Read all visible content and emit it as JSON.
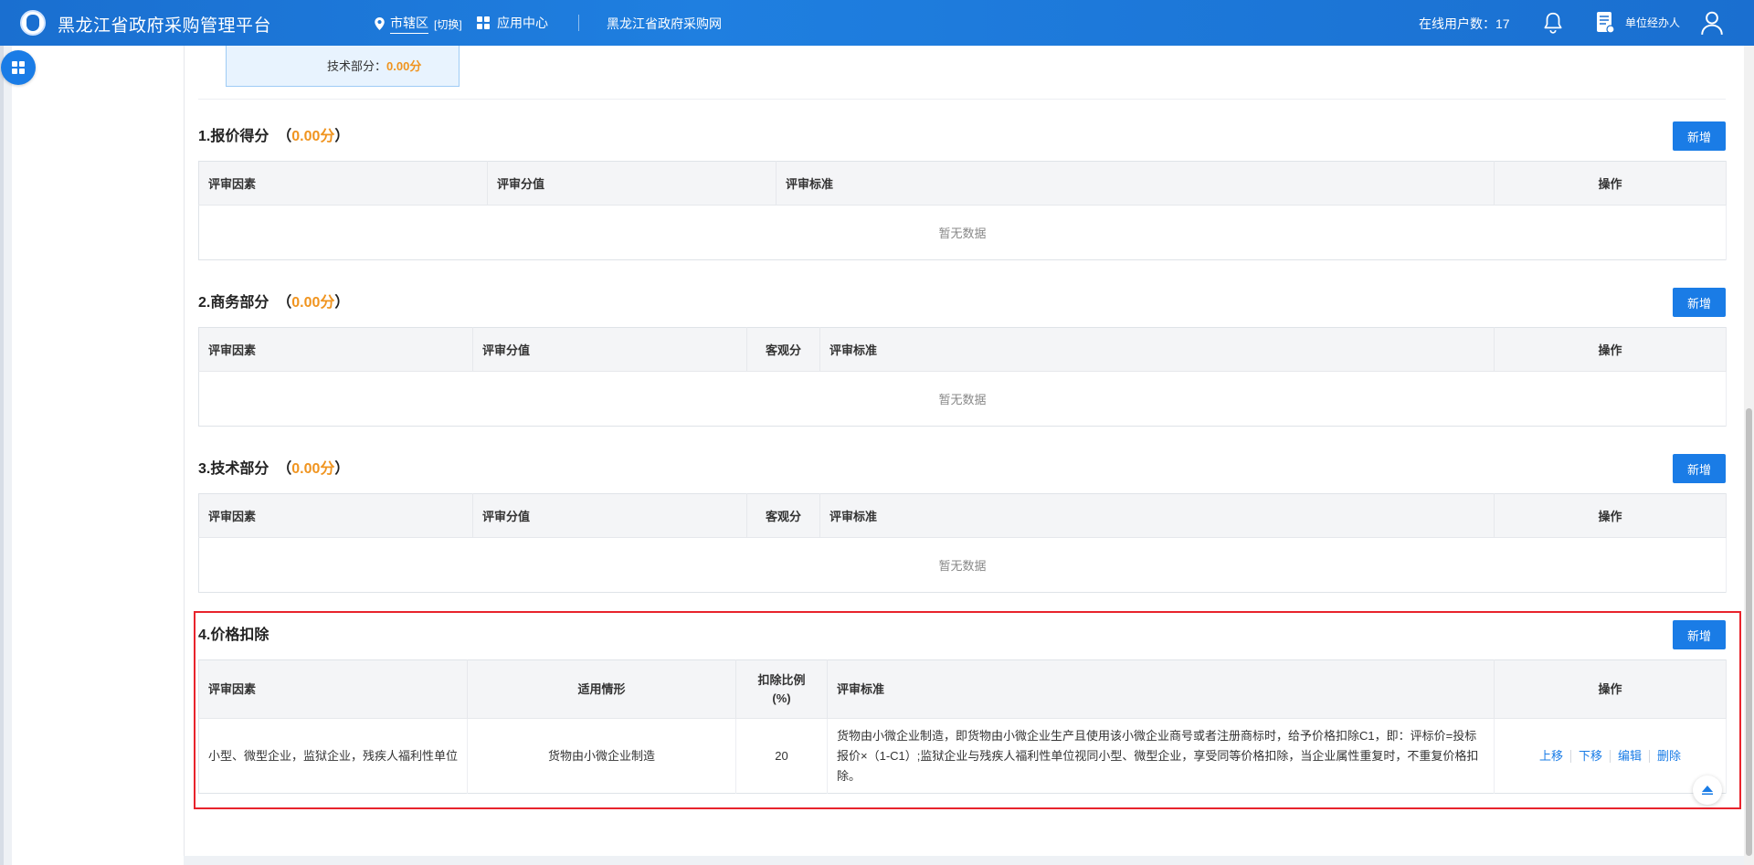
{
  "header": {
    "title": "黑龙江省政府采购管理平台",
    "region": "市辖区",
    "region_switch": "[切换]",
    "app_center": "应用中心",
    "portal_link": "黑龙江省政府采购网",
    "online_label": "在线用户数：17",
    "role": "单位经办人"
  },
  "summary": {
    "tech_label": "技术部分：",
    "tech_score": "0.00分"
  },
  "sections": [
    {
      "title": "1.报价得分",
      "score": "0.00分",
      "add_label": "新增",
      "columns": [
        "评审因素",
        "评审分值",
        "评审标准",
        "操作"
      ],
      "empty_text": "暂无数据"
    },
    {
      "title": "2.商务部分",
      "score": "0.00分",
      "add_label": "新增",
      "columns": [
        "评审因素",
        "评审分值",
        "客观分",
        "评审标准",
        "操作"
      ],
      "empty_text": "暂无数据"
    },
    {
      "title": "3.技术部分",
      "score": "0.00分",
      "add_label": "新增",
      "columns": [
        "评审因素",
        "评审分值",
        "客观分",
        "评审标准",
        "操作"
      ],
      "empty_text": "暂无数据"
    },
    {
      "title": "4.价格扣除",
      "add_label": "新增",
      "columns": [
        "评审因素",
        "适用情形",
        "扣除比例",
        "(%)",
        "评审标准",
        "操作"
      ],
      "rows": [
        {
          "factor": "小型、微型企业，监狱企业，残疾人福利性单位",
          "situation": "货物由小微企业制造",
          "ratio": "20",
          "standard": "货物由小微企业制造，即货物由小微企业生产且使用该小微企业商号或者注册商标时，给予价格扣除C1，即：评标价=投标报价×（1-C1）;监狱企业与残疾人福利性单位视同小型、微型企业，享受同等价格扣除，当企业属性重复时，不重复价格扣除。",
          "ops": [
            "上移",
            "下移",
            "编辑",
            "删除"
          ]
        }
      ]
    }
  ]
}
